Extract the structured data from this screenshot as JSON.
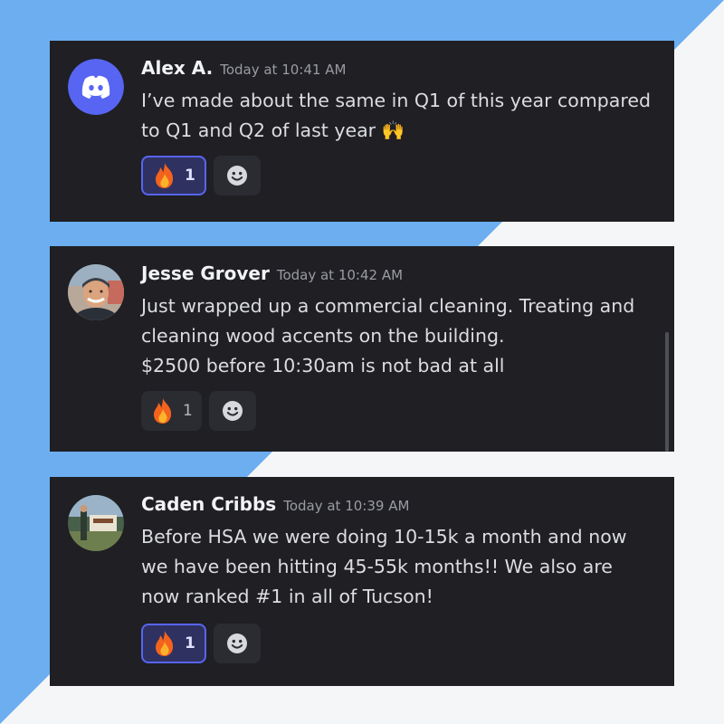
{
  "colors": {
    "blue": "#6caef0",
    "white": "#f5f6f7",
    "card": "#1f1f24",
    "discord_blurple": "#5865f2"
  },
  "messages": [
    {
      "username": "Alex A.",
      "timestamp": "Today at 10:41 AM",
      "avatar_icon": "discord-logo-icon",
      "lines": [
        "I’ve made about the same in Q1 of this year compared",
        "to Q1 and Q2 of last year 🙌"
      ],
      "reaction": {
        "emoji": "fire-icon",
        "count": "1",
        "active": true
      }
    },
    {
      "username": "Jesse Grover",
      "timestamp": "Today at 10:42 AM",
      "avatar_icon": "user-photo",
      "lines": [
        "Just wrapped up a commercial cleaning. Treating and",
        "cleaning wood accents on the building.",
        "$2500 before 10:30am is not bad at all"
      ],
      "reaction": {
        "emoji": "fire-icon",
        "count": "1",
        "active": false
      }
    },
    {
      "username": "Caden Cribbs",
      "timestamp": "Today at 10:39 AM",
      "avatar_icon": "user-photo",
      "lines": [
        "Before HSA we were doing 10-15k a month and now",
        "we have been hitting 45-55k months!! We also are",
        "now ranked #1 in all of Tucson!"
      ],
      "reaction": {
        "emoji": "fire-icon",
        "count": "1",
        "active": true
      }
    }
  ]
}
